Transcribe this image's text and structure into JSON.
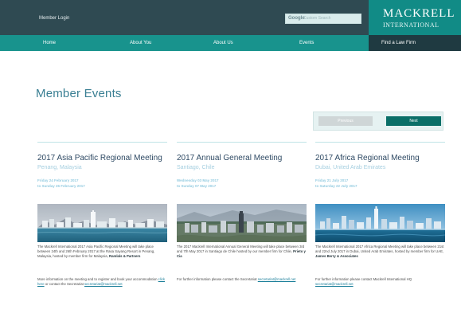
{
  "header": {
    "member_login": "Member Login",
    "search": {
      "brand": "Google",
      "placeholder": "Custom Search"
    },
    "logo": {
      "line1": "MACKRELL",
      "line2": "INTERNATIONAL"
    }
  },
  "nav": [
    {
      "label": "Home"
    },
    {
      "label": "About You"
    },
    {
      "label": "About Us"
    },
    {
      "label": "Events"
    },
    {
      "label": "Find a Law Firm",
      "active": true
    }
  ],
  "main": {
    "title": "Member Events",
    "pager": {
      "prev": "Previous",
      "next": "Next"
    },
    "events": [
      {
        "title": "2017 Asia Pacific Regional Meeting",
        "location": "Penang, Malaysia",
        "date_line1": "Friday 24 February 2017",
        "date_line2": "to Sunday 26 February 2017",
        "desc_pre": "The Mackrell International 2017 Asia Pacific Regional Meeting will take place between 24th and 26th February 2017 at the Rasa Sayang Resort in Penang, Malaysia, hosted by member firm for Malaysia, ",
        "desc_host": "Ramlals & Partners",
        "more_pre": "More information on the meeting and to register and book your accommodation ",
        "more_link": "click here",
        "more_mid": " or contact the Secretariat ",
        "more_email": "secretariat@mackrell.net"
      },
      {
        "title": "2017 Annual General Meeting",
        "location": "Santiago, Chile",
        "date_line1": "Wednesday 03 May 2017",
        "date_line2": "to Sunday 07 May 2017",
        "desc_pre": "The 2017 Mackrell International Annual General Meeting will take place between 3rd and 7th May 2017 in Santiago de Chile hosted by our member firm for Chile, ",
        "desc_host": "Prieto y Cia",
        "more_pre": "For further information please contact the Secretariat ",
        "more_email": "secretariat@mackrell.net"
      },
      {
        "title": "2017 Africa Regional Meeting",
        "location": "Dubai, United Arab Emirates",
        "date_line1": "Friday 21 July 2017",
        "date_line2": "to Saturday 22 July 2017",
        "desc_pre": "The Mackrell International 2017 Africa Regional Meeting will take place between 21st and 22nd July 2017 in Dubai, United Arab Emirates, hosted by member firm for UAE, ",
        "desc_host": "James Berry & Associates",
        "more_pre": "For further information please contact Mackrell International HQ ",
        "more_email": "secretariat@mackrell.net"
      }
    ]
  }
}
